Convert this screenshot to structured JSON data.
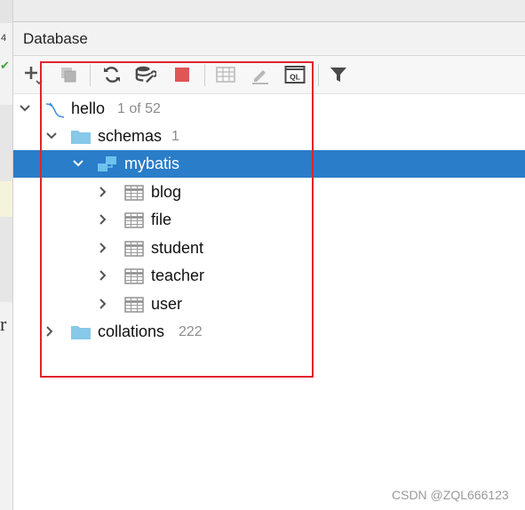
{
  "editor_gutter": {
    "line_number": "4",
    "fragment": "r"
  },
  "panel": {
    "title": "Database"
  },
  "toolbar": {
    "buttons": [
      {
        "name": "add-icon"
      },
      {
        "name": "duplicate-icon"
      },
      {
        "name": "refresh-icon"
      },
      {
        "name": "data-source-properties-icon"
      },
      {
        "name": "stop-icon"
      },
      {
        "name": "table-view-icon"
      },
      {
        "name": "edit-icon"
      },
      {
        "name": "query-console-icon",
        "glyph": "QL"
      },
      {
        "name": "filter-icon"
      }
    ]
  },
  "tree": {
    "connection": {
      "label": "hello",
      "count": "1 of 52"
    },
    "schemas": {
      "label": "schemas",
      "count": "1"
    },
    "schema": {
      "label": "mybatis",
      "selected": true
    },
    "tables": [
      "blog",
      "file",
      "student",
      "teacher",
      "user"
    ],
    "collations": {
      "label": "collations",
      "count": "222"
    }
  },
  "colors": {
    "selection": "#2a7dc9",
    "highlight_box": "#e0242b",
    "folder": "#86c9e8"
  },
  "watermark": "CSDN @ZQL666123"
}
